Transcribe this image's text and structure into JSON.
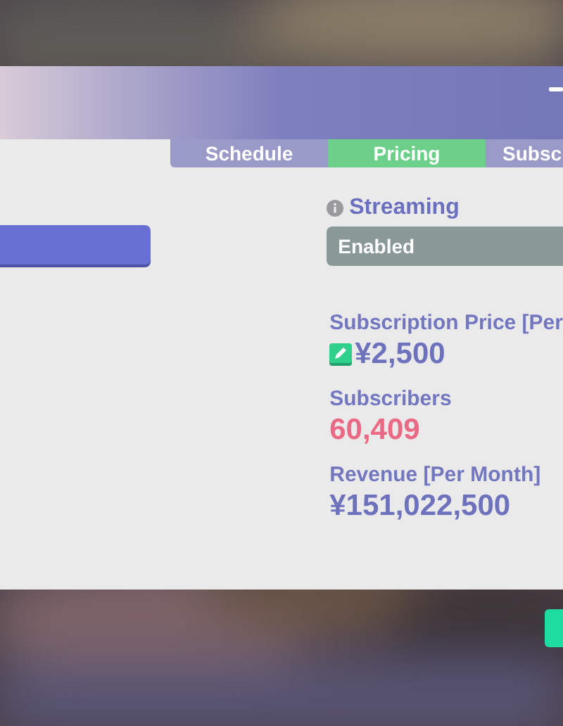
{
  "tabs": [
    {
      "label": "Schedule",
      "selected": false
    },
    {
      "label": "Pricing",
      "selected": true
    },
    {
      "label": "Subsc",
      "selected": false
    }
  ],
  "streaming": {
    "label": "Streaming",
    "value": "Enabled"
  },
  "stats": [
    {
      "kind": "editable",
      "label": "Subscription Price [Per",
      "value": "¥2,500"
    },
    {
      "kind": "alert",
      "label": "Subscribers",
      "value": "60,409"
    },
    {
      "kind": "plain",
      "label": "Revenue [Per Month]",
      "value": "¥151,022,500"
    }
  ]
}
